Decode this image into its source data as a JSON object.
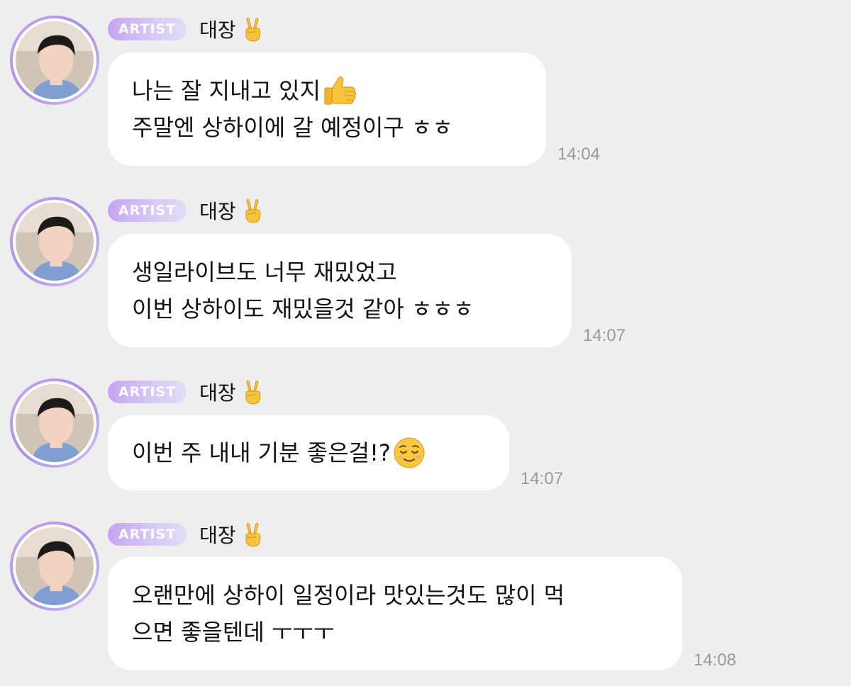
{
  "messages": [
    {
      "badge": "ARTIST",
      "sender": "대장",
      "sender_emoji": "victory-hand",
      "lines": [
        "나는 잘 지내고 있지",
        "주말엔 상하이에 갈 예정이구 ㅎㅎ"
      ],
      "line_emojis": [
        "thumbs-up",
        ""
      ],
      "time": "14:04"
    },
    {
      "badge": "ARTIST",
      "sender": "대장",
      "sender_emoji": "victory-hand",
      "lines": [
        "생일라이브도 너무 재밌었고",
        "이번 상하이도 재밌을것 같아 ㅎㅎㅎ"
      ],
      "line_emojis": [
        "",
        ""
      ],
      "time": "14:07"
    },
    {
      "badge": "ARTIST",
      "sender": "대장",
      "sender_emoji": "victory-hand",
      "lines": [
        "이번 주 내내 기분 좋은걸!?"
      ],
      "line_emojis": [
        "relieved-face"
      ],
      "time": "14:07"
    },
    {
      "badge": "ARTIST",
      "sender": "대장",
      "sender_emoji": "victory-hand",
      "lines": [
        "오랜만에 상하이 일정이라 맛있는것도 많이 먹",
        "으면 좋을텐데 ㅜㅜㅜ"
      ],
      "line_emojis": [
        "",
        ""
      ],
      "time": "14:08"
    }
  ],
  "colors": {
    "background": "#eeeeee",
    "bubble": "#ffffff",
    "badge_gradient_start": "#c4a5f0",
    "badge_gradient_end": "#e3dbf7",
    "timestamp": "#9a9a9a",
    "avatar_ring": "#b99aea"
  }
}
